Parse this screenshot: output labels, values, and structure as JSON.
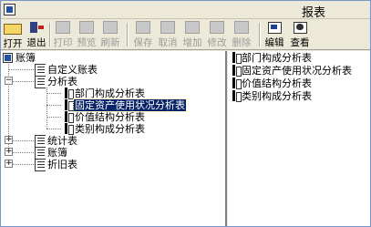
{
  "window": {
    "title": "报表",
    "app_icon": "app-icon"
  },
  "toolbar": {
    "buttons": [
      {
        "label": "打开",
        "icon": "open-folder-icon",
        "enabled": true
      },
      {
        "label": "退出",
        "icon": "exit-door-icon",
        "enabled": true
      },
      {
        "label": "打印",
        "icon": "printer-icon",
        "enabled": false
      },
      {
        "label": "预览",
        "icon": "preview-icon",
        "enabled": false
      },
      {
        "label": "刷新",
        "icon": "refresh-icon",
        "enabled": false
      },
      {
        "label": "保存",
        "icon": "save-icon",
        "enabled": false
      },
      {
        "label": "取消",
        "icon": "cancel-icon",
        "enabled": false
      },
      {
        "label": "增加",
        "icon": "add-icon",
        "enabled": false
      },
      {
        "label": "修改",
        "icon": "modify-icon",
        "enabled": false
      },
      {
        "label": "删除",
        "icon": "delete-icon",
        "enabled": false
      },
      {
        "label": "编辑",
        "icon": "edit-icon",
        "enabled": true
      },
      {
        "label": "查看",
        "icon": "view-icon",
        "enabled": true
      }
    ]
  },
  "tree": {
    "root": "账簿",
    "nodes": {
      "custom": "自定义账表",
      "analysis": "分析表",
      "dept": "部门构成分析表",
      "fixed_asset": "固定资产使用状况分析表",
      "value": "价值结构分析表",
      "category": "类别构成分析表",
      "stats": "统计表",
      "ledger": "账簿",
      "depr": "折旧表"
    },
    "selected": "固定资产使用状况分析表"
  },
  "list": {
    "items": [
      "部门构成分析表",
      "固定资产使用状况分析表",
      "价值结构分析表",
      "类别构成分析表"
    ]
  }
}
